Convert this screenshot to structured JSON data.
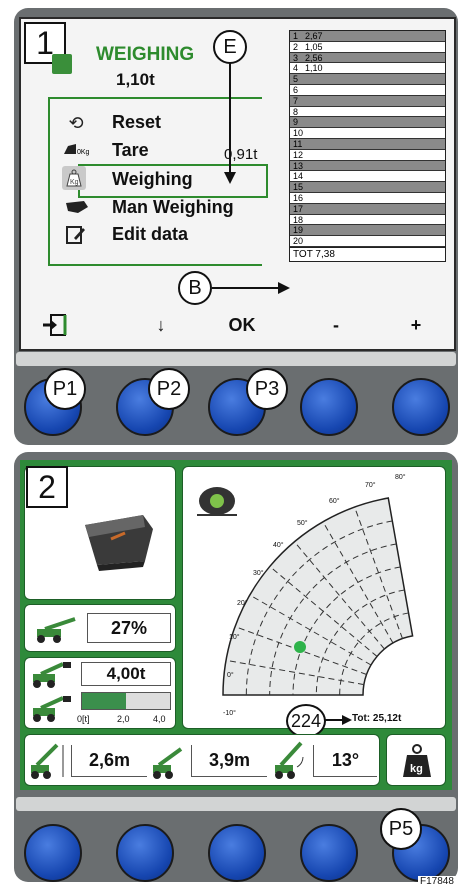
{
  "panel1": {
    "number": "1",
    "title": "WEIGHING",
    "value": "1,10t",
    "menu": [
      {
        "label": "Reset",
        "icon": "reset-icon"
      },
      {
        "label": "Tare",
        "icon": "tare-icon",
        "value": "0,91t",
        "icon_text": "0Kg"
      },
      {
        "label": "Weighing",
        "icon": "weigh-kg-icon",
        "icon_text": "Kg"
      },
      {
        "label": "Man Weighing",
        "icon": "hand-icon"
      },
      {
        "label": "Edit data",
        "icon": "edit-icon"
      }
    ],
    "table": {
      "rows": [
        {
          "n": "1",
          "v": "2,67"
        },
        {
          "n": "2",
          "v": "1,05"
        },
        {
          "n": "3",
          "v": "2,56"
        },
        {
          "n": "4",
          "v": "1,10"
        },
        {
          "n": "5",
          "v": ""
        },
        {
          "n": "6",
          "v": ""
        },
        {
          "n": "7",
          "v": ""
        },
        {
          "n": "8",
          "v": ""
        },
        {
          "n": "9",
          "v": ""
        },
        {
          "n": "10",
          "v": ""
        },
        {
          "n": "11",
          "v": ""
        },
        {
          "n": "12",
          "v": ""
        },
        {
          "n": "13",
          "v": ""
        },
        {
          "n": "14",
          "v": ""
        },
        {
          "n": "15",
          "v": ""
        },
        {
          "n": "16",
          "v": ""
        },
        {
          "n": "17",
          "v": ""
        },
        {
          "n": "18",
          "v": ""
        },
        {
          "n": "19",
          "v": ""
        },
        {
          "n": "20",
          "v": ""
        }
      ],
      "total": "TOT 7,38"
    },
    "callouts": {
      "e": "E",
      "b": "B"
    },
    "softkeys": {
      "exit_icon": "exit-icon",
      "down": "↓",
      "ok": "OK",
      "minus": "-",
      "plus": "+"
    }
  },
  "buttons_top": {
    "p1": "P1",
    "p2": "P2",
    "p3": "P3"
  },
  "panel2": {
    "number": "2",
    "percent": "27%",
    "load": "4,00t",
    "load_fraction": 0.5,
    "scale": {
      "min": "0[t]",
      "mid": "2,0",
      "max": "4,0"
    },
    "chart": {
      "angles": [
        "80°",
        "70°",
        "60°",
        "50°",
        "40°",
        "30°",
        "20°",
        "10°",
        "0°",
        "-10°"
      ],
      "callout": "224",
      "tot": "Tot: 25,12t"
    },
    "bottom": {
      "height": "2,6m",
      "reach": "3,9m",
      "angle": "13°",
      "kg_label": "kg"
    }
  },
  "buttons_bottom": {
    "p5": "P5"
  },
  "figure_code": "F17848",
  "colors": {
    "green": "#2e8b2e",
    "button_blue": "#1646b0",
    "housing": "#6a6e70"
  }
}
